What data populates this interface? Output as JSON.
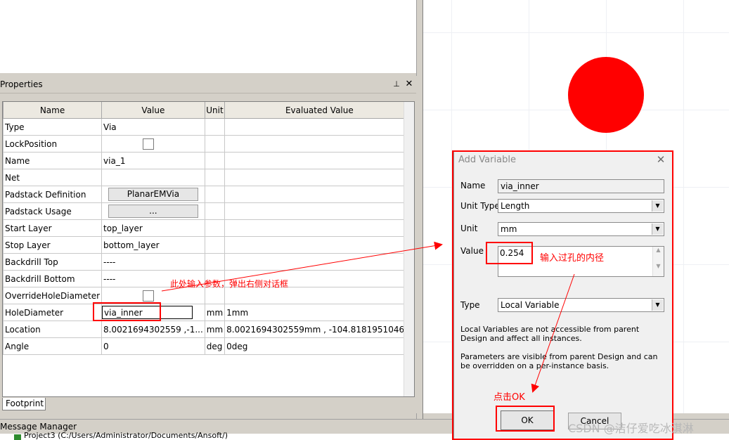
{
  "properties_panel": {
    "title": "Properties",
    "pin_glyph": "⊥",
    "close_glyph": "✕",
    "columns": [
      "Name",
      "Value",
      "Unit",
      "Evaluated Value"
    ],
    "rows": [
      {
        "name": "Type",
        "value": "Via",
        "unit": "",
        "evaluated": ""
      },
      {
        "name": "LockPosition",
        "value": "",
        "unit": "",
        "evaluated": ""
      },
      {
        "name": "Name",
        "value": "via_1",
        "unit": "",
        "evaluated": ""
      },
      {
        "name": "Net",
        "value": "",
        "unit": "",
        "evaluated": ""
      },
      {
        "name": "Padstack Definition",
        "value": "PlanarEMVia",
        "unit": "",
        "evaluated": ""
      },
      {
        "name": "Padstack Usage",
        "value": "...",
        "unit": "",
        "evaluated": ""
      },
      {
        "name": "Start Layer",
        "value": "top_layer",
        "unit": "",
        "evaluated": ""
      },
      {
        "name": "Stop Layer",
        "value": "bottom_layer",
        "unit": "",
        "evaluated": ""
      },
      {
        "name": "Backdrill Top",
        "value": "----",
        "unit": "",
        "evaluated": ""
      },
      {
        "name": "Backdrill Bottom",
        "value": "----",
        "unit": "",
        "evaluated": ""
      },
      {
        "name": "OverrideHoleDiameter",
        "value": "",
        "unit": "",
        "evaluated": ""
      },
      {
        "name": "HoleDiameter",
        "value": "via_inner",
        "unit": "mm",
        "evaluated": "1mm"
      },
      {
        "name": "Location",
        "value": "8.0021694302559 ,-1...",
        "unit": "mm",
        "evaluated": "8.0021694302559mm , -104.8181951046..."
      },
      {
        "name": "Angle",
        "value": "0",
        "unit": "deg",
        "evaluated": "0deg"
      }
    ],
    "footprint_tab": "Footprint"
  },
  "message_manager": {
    "title": "Message Manager",
    "row_text": "Project3 (C:/Users/Administrator/Documents/Ansoft/)"
  },
  "dialog": {
    "title": "Add Variable",
    "close_glyph": "✕",
    "name_label": "Name",
    "name_value": "via_inner",
    "unit_type_label": "Unit Type",
    "unit_type_value": "Length",
    "unit_label": "Unit",
    "unit_value": "mm",
    "value_label": "Value",
    "value_value": "0.254",
    "type_label": "Type",
    "type_value": "Local Variable",
    "note_local": "Local Variables are not accessible from parent Design and affect all instances.",
    "note_params": "Parameters are visible from parent Design and can be overridden on a per-instance basis.",
    "ok_label": "OK",
    "cancel_label": "Cancel"
  },
  "annotations": {
    "hole_note": "此处输入参数，弹出右侧对话框",
    "value_note": "输入过孔的内径",
    "ok_note": "点击OK",
    "color": "#ff0000"
  },
  "watermark": "CSDN @洁仔爱吃冰淇淋",
  "canvas": {
    "via_color": "#ff0000"
  }
}
